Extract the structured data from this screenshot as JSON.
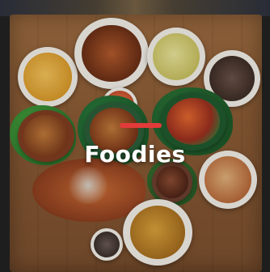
{
  "brand": {
    "title": "Foodies",
    "accent_color": "#e23a3a"
  }
}
